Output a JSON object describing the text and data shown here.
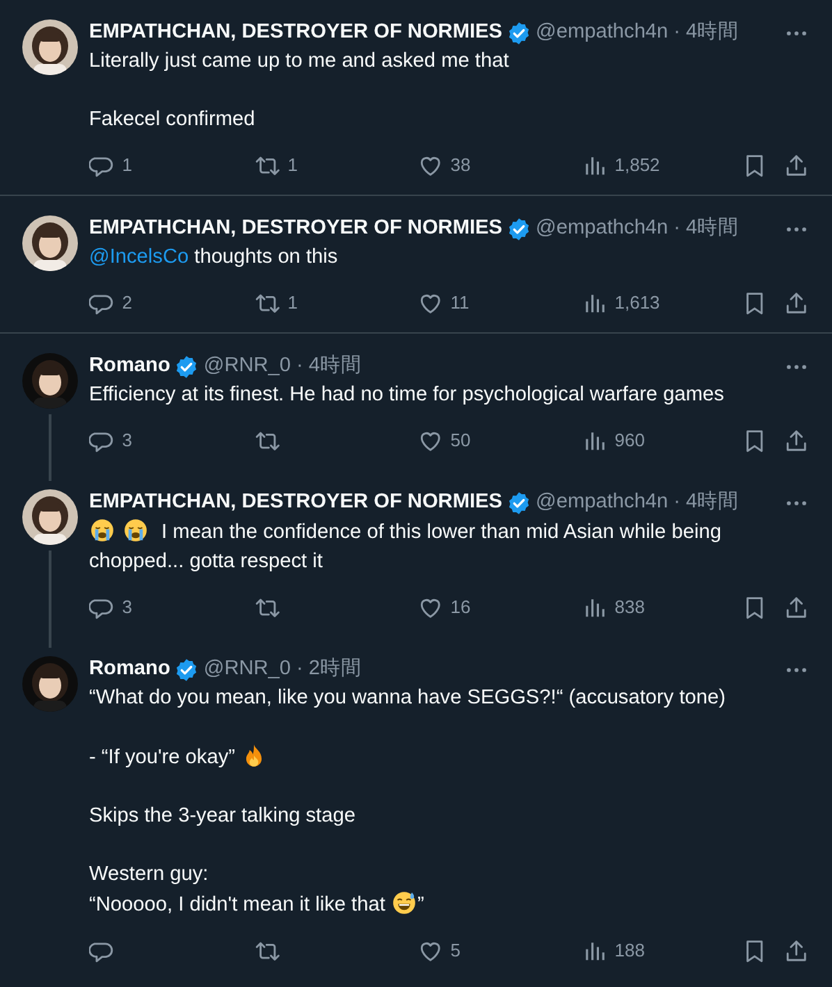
{
  "tweets": [
    {
      "name": "EMPATHCHAN, DESTROYER OF NORMIES",
      "verified": true,
      "handle": "@empathch4n",
      "separator": "·",
      "time": "4時間",
      "thread_above": false,
      "thread_below": false,
      "divider": true,
      "paragraphs": [
        [
          [
            {
              "kind": "text",
              "text": "Literally just came up to me and asked me that"
            }
          ]
        ],
        [
          [
            {
              "kind": "text",
              "text": "Fakecel confirmed"
            }
          ]
        ]
      ],
      "stats": {
        "replies": "1",
        "reposts": "1",
        "likes": "38",
        "views": "1,852"
      }
    },
    {
      "name": "EMPATHCHAN, DESTROYER OF NORMIES",
      "verified": true,
      "handle": "@empathch4n",
      "separator": "·",
      "time": "4時間",
      "thread_above": false,
      "thread_below": false,
      "divider": true,
      "paragraphs": [
        [
          [
            {
              "kind": "mention",
              "text": "@IncelsCo"
            },
            {
              "kind": "text",
              "text": " thoughts on this"
            }
          ]
        ]
      ],
      "stats": {
        "replies": "2",
        "reposts": "1",
        "likes": "11",
        "views": "1,613"
      }
    },
    {
      "name": "Romano",
      "verified": true,
      "handle": "@RNR_0",
      "separator": "·",
      "time": "4時間",
      "thread_above": false,
      "thread_below": true,
      "divider": false,
      "paragraphs": [
        [
          [
            {
              "kind": "text",
              "text": "Efficiency at its finest. He had no time for psychological warfare games"
            }
          ]
        ]
      ],
      "stats": {
        "replies": "3",
        "likes": "50",
        "views": "960"
      }
    },
    {
      "name": "EMPATHCHAN, DESTROYER OF NORMIES",
      "verified": true,
      "handle": "@empathch4n",
      "separator": "·",
      "time": "4時間",
      "thread_above": true,
      "thread_below": true,
      "divider": false,
      "paragraphs": [
        [
          [
            {
              "kind": "crying"
            },
            {
              "kind": "crying"
            },
            {
              "kind": "text",
              "text": " I mean the confidence of this lower than mid Asian while being chopped... gotta respect it"
            }
          ]
        ]
      ],
      "stats": {
        "replies": "3",
        "likes": "16",
        "views": "838"
      }
    },
    {
      "name": "Romano",
      "verified": true,
      "handle": "@RNR_0",
      "separator": "·",
      "time": "2時間",
      "thread_above": true,
      "thread_below": false,
      "divider": false,
      "paragraphs": [
        [
          [
            {
              "kind": "text",
              "text": "“What do you mean, like you wanna have SEGGS?!“ (accusatory tone)"
            }
          ]
        ],
        [
          [
            {
              "kind": "text",
              "text": "- “If you're okay” "
            },
            {
              "kind": "fire"
            }
          ]
        ],
        [
          [
            {
              "kind": "text",
              "text": "Skips the 3-year talking stage"
            }
          ]
        ],
        [
          [
            {
              "kind": "text",
              "text": "Western guy:"
            }
          ],
          [
            {
              "kind": "text",
              "text": "“Nooooo, I didn't mean it like that "
            },
            {
              "kind": "sweatsmile"
            },
            {
              "kind": "text",
              "text": "”"
            }
          ]
        ]
      ],
      "stats": {
        "likes": "5",
        "views": "188"
      }
    }
  ]
}
